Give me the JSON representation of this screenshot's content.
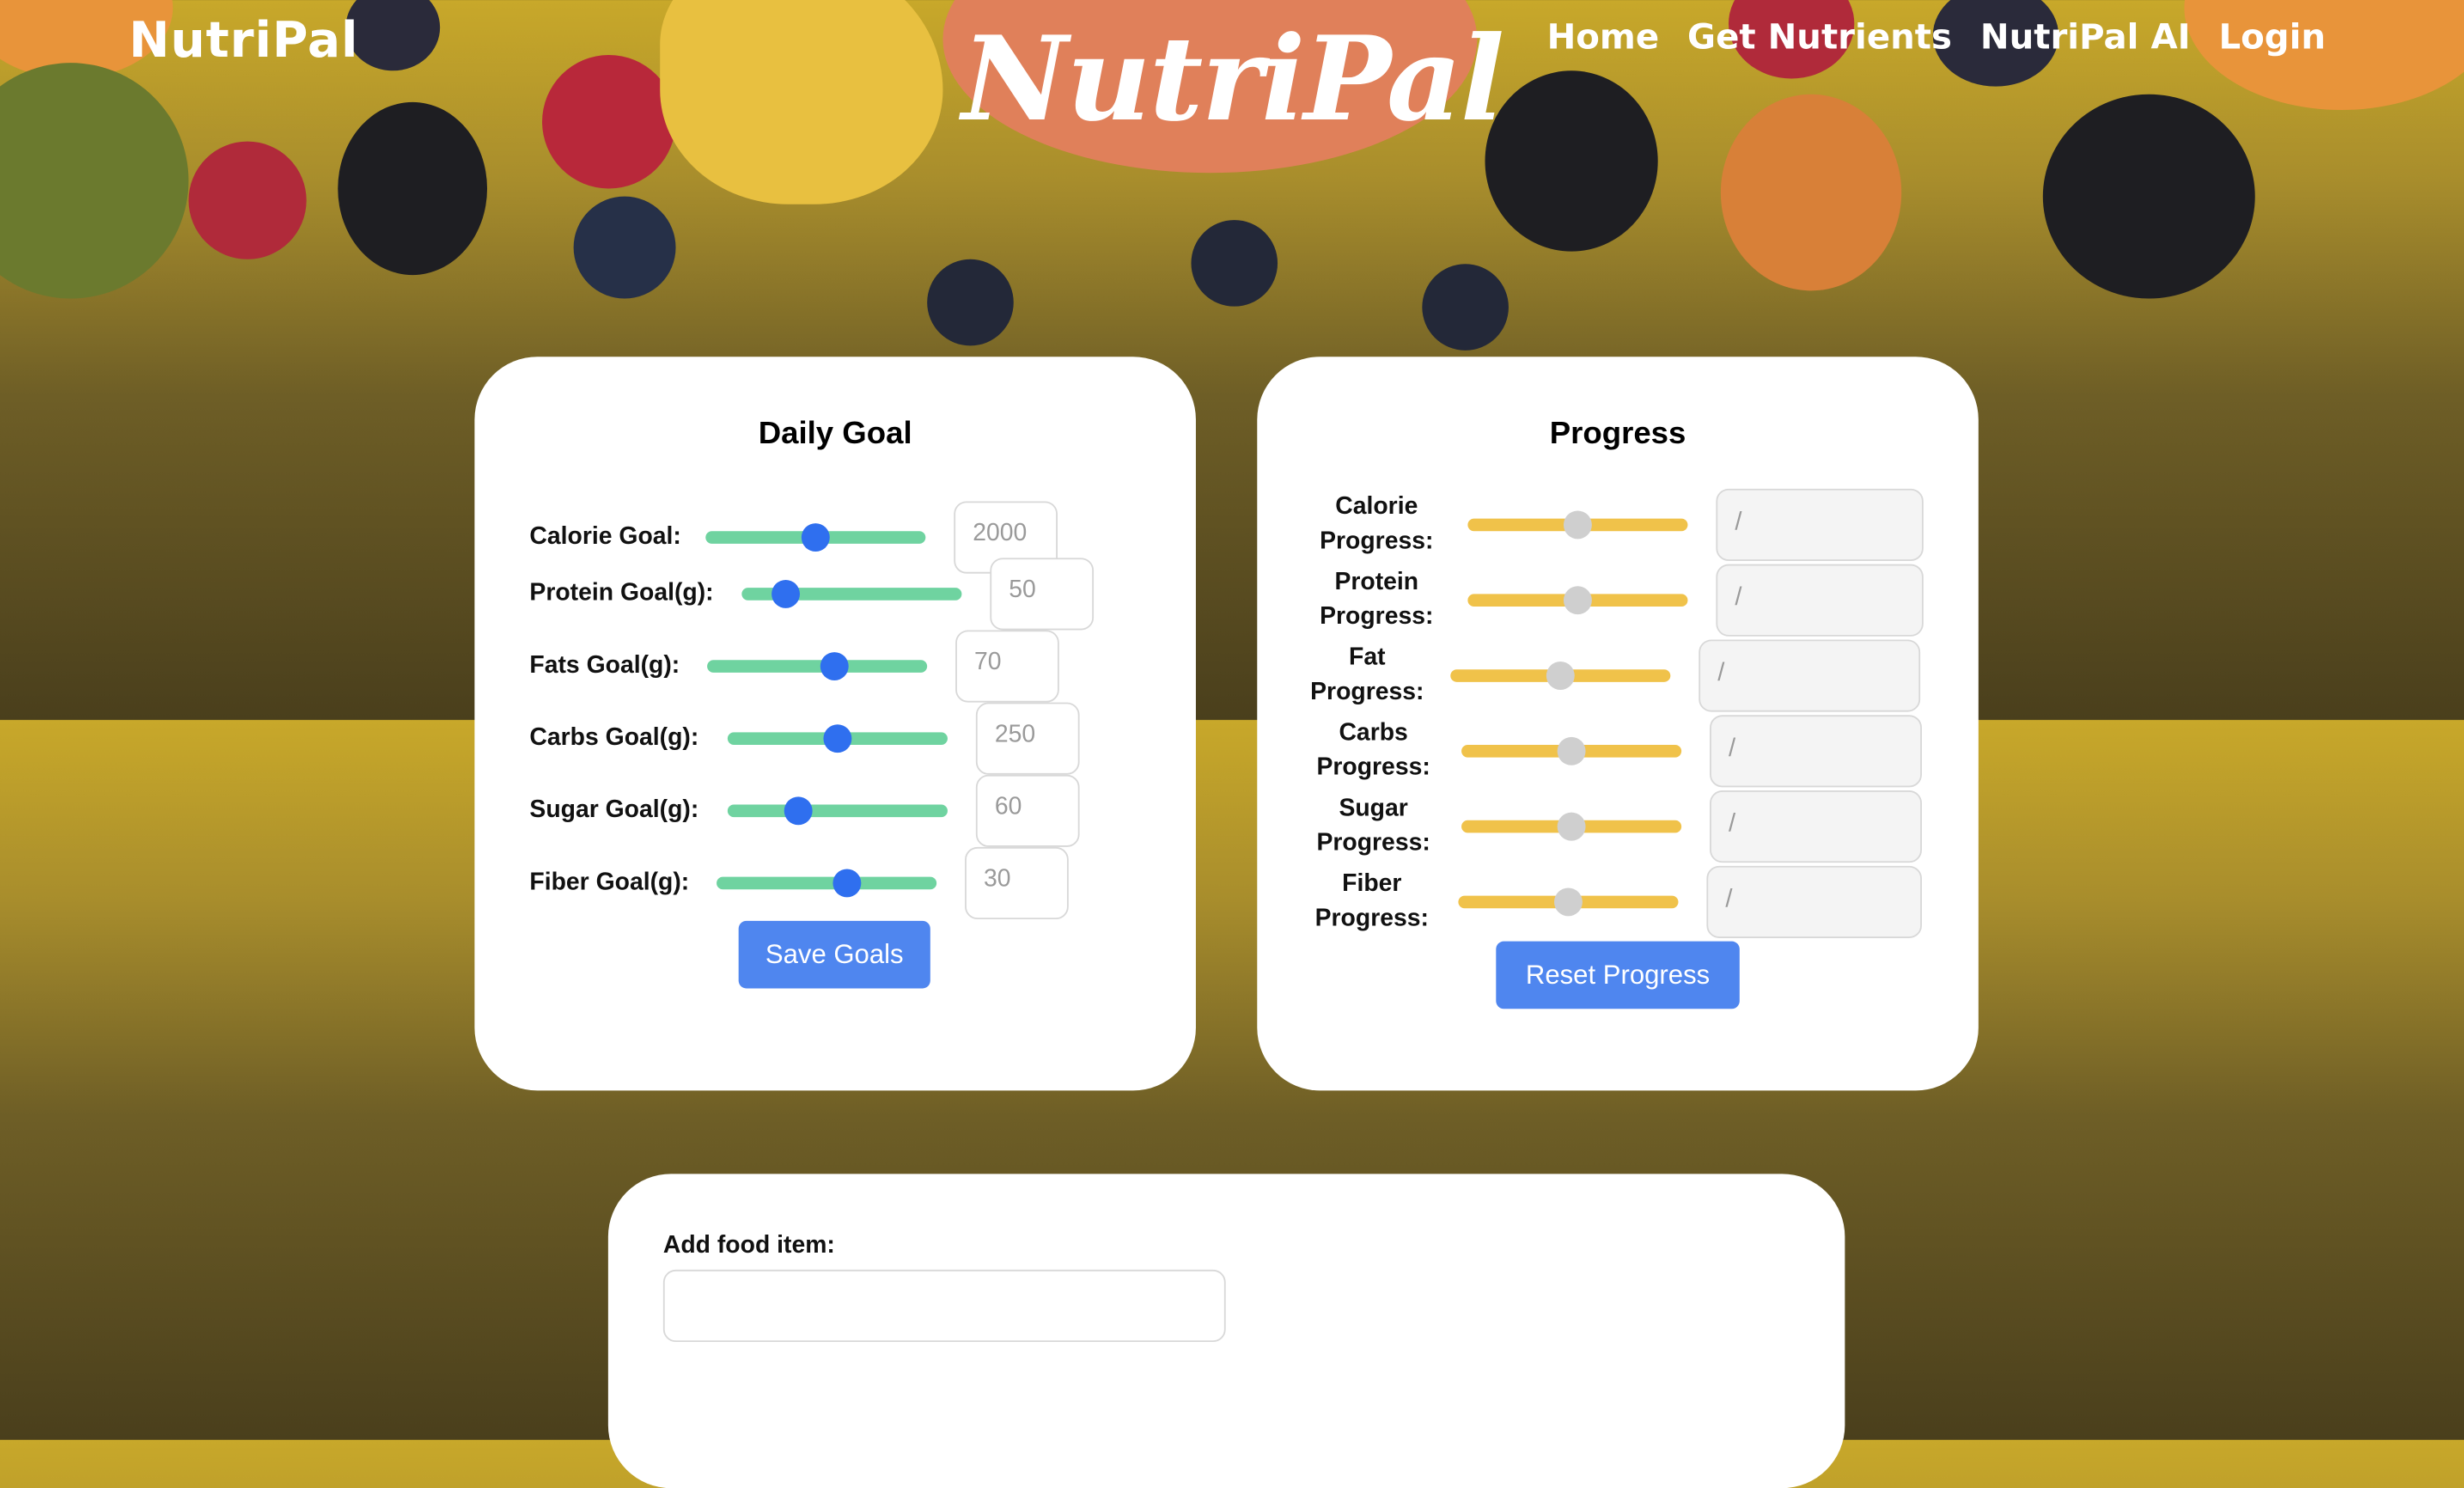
{
  "nav": {
    "brand_small": "NutriPal",
    "brand_big": "NutriPal",
    "links": [
      "Home",
      "Get Nutrients",
      "NutriPal AI",
      "Login"
    ]
  },
  "goals": {
    "title": "Daily Goal",
    "items": [
      {
        "label": "Calorie Goal:",
        "value": "2000",
        "slider_fraction": 0.5
      },
      {
        "label": "Protein Goal(g):",
        "value": "50",
        "slider_fraction": 0.2
      },
      {
        "label": "Fats Goal(g):",
        "value": "70",
        "slider_fraction": 0.58
      },
      {
        "label": "Carbs Goal(g):",
        "value": "250",
        "slider_fraction": 0.5
      },
      {
        "label": "Sugar Goal(g):",
        "value": "60",
        "slider_fraction": 0.32
      },
      {
        "label": "Fiber Goal(g):",
        "value": "30",
        "slider_fraction": 0.59
      }
    ],
    "save_label": "Save Goals"
  },
  "progress": {
    "title": "Progress",
    "items": [
      {
        "label_line1": "Calorie",
        "label_line2": "Progress:",
        "value": "/",
        "slider_fraction": 0.5
      },
      {
        "label_line1": "Protein",
        "label_line2": "Progress:",
        "value": "/",
        "slider_fraction": 0.5
      },
      {
        "label_line1": "Fat",
        "label_line2": "Progress:",
        "value": "/",
        "slider_fraction": 0.5
      },
      {
        "label_line1": "Carbs",
        "label_line2": "Progress:",
        "value": "/",
        "slider_fraction": 0.5
      },
      {
        "label_line1": "Sugar",
        "label_line2": "Progress:",
        "value": "/",
        "slider_fraction": 0.5
      },
      {
        "label_line1": "Fiber",
        "label_line2": "Progress:",
        "value": "/",
        "slider_fraction": 0.5
      }
    ],
    "reset_label": "Reset Progress"
  },
  "food": {
    "label": "Add food item:",
    "input_value": ""
  },
  "colors": {
    "goal_track": "#6fd3a0",
    "goal_thumb": "#2f6fef",
    "progress_track": "#f0c24a",
    "progress_thumb": "#cfcfcf",
    "button": "#4f86ef"
  }
}
